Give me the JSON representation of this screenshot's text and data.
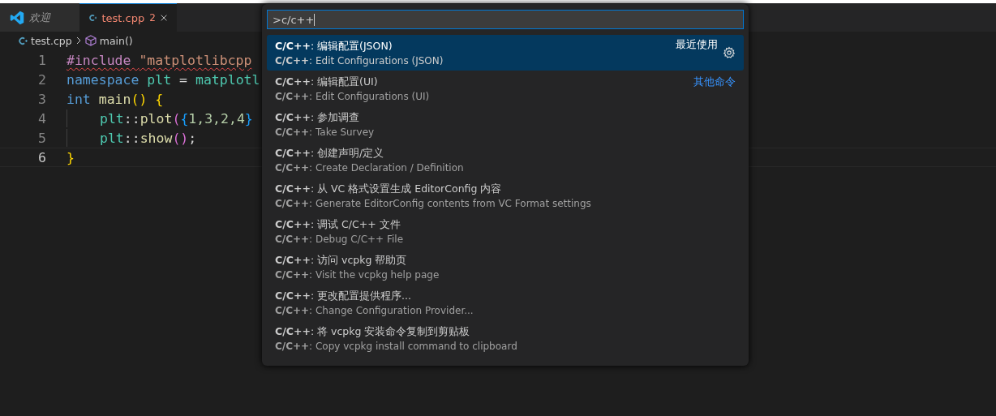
{
  "tabs": [
    {
      "kind": "welcome",
      "label": "欢迎",
      "selected": false,
      "preview": true
    },
    {
      "kind": "cpp",
      "label": "test.cpp",
      "problems": "2",
      "selected": true,
      "preview": false
    }
  ],
  "breadcrumb": [
    {
      "kind": "cpp",
      "label": "test.cpp"
    },
    {
      "kind": "symbol",
      "label": "main()"
    }
  ],
  "code": [
    {
      "number": "1",
      "current": false,
      "error": true,
      "tokens": [
        {
          "text": "#include ",
          "kind": "directive"
        },
        {
          "text": "\"matplotlibcpp",
          "kind": "string"
        }
      ]
    },
    {
      "number": "2",
      "current": false,
      "error": false,
      "tokens": [
        {
          "text": "namespace ",
          "kind": "keyword"
        },
        {
          "text": "plt",
          "kind": "type"
        },
        {
          "text": " = ",
          "kind": "plain"
        },
        {
          "text": "matplotl",
          "kind": "type"
        }
      ]
    },
    {
      "number": "3",
      "current": false,
      "error": false,
      "tokens": [
        {
          "text": "int ",
          "kind": "keyword"
        },
        {
          "text": "main",
          "kind": "function"
        },
        {
          "text": "() ",
          "kind": "bracket1"
        },
        {
          "text": "{",
          "kind": "bracket1"
        }
      ],
      "children": [
        {
          "number": "4",
          "current": false,
          "error": false,
          "tokens": [
            {
              "text": "plt",
              "kind": "type"
            },
            {
              "text": "::",
              "kind": "plain"
            },
            {
              "text": "plot",
              "kind": "function"
            },
            {
              "text": "(",
              "kind": "bracket2"
            },
            {
              "text": "{",
              "kind": "bracket3"
            },
            {
              "text": "1,3,2,4",
              "kind": "number"
            },
            {
              "text": "}",
              "kind": "bracket3"
            }
          ]
        },
        {
          "number": "5",
          "current": false,
          "error": false,
          "tokens": [
            {
              "text": "plt",
              "kind": "type"
            },
            {
              "text": "::",
              "kind": "plain"
            },
            {
              "text": "show",
              "kind": "function"
            },
            {
              "text": "()",
              "kind": "bracket2"
            },
            {
              "text": ";",
              "kind": "plain"
            }
          ]
        }
      ]
    },
    {
      "number": "6",
      "current": true,
      "error": false,
      "tokens": [
        {
          "text": "}",
          "kind": "bracket1"
        }
      ]
    }
  ],
  "palette": {
    "input": ">c/c++",
    "items": [
      {
        "title": "**C/C++**: 编辑配置(JSON)",
        "detail": "**C/C++**: Edit Configurations (JSON)",
        "selected": true,
        "badge": "最近使用",
        "gear": true
      },
      {
        "title": "**C/C++**: 编辑配置(UI)",
        "detail": "**C/C++**: Edit Configurations (UI)",
        "selected": false,
        "link": "其他命令"
      },
      {
        "title": "**C/C++**: 参加调查",
        "detail": "**C/C++**: Take Survey",
        "selected": false
      },
      {
        "title": "**C/C++**: 创建声明/定义",
        "detail": "**C/C++**: Create Declaration / Definition",
        "selected": false
      },
      {
        "title": "**C/C++**: 从 VC 格式设置生成 EditorConfig 内容",
        "detail": "**C/C++**: Generate EditorConfig contents from VC Format settings",
        "selected": false
      },
      {
        "title": "**C/C++**: 调试 C/C++ 文件",
        "detail": "**C/C++**: Debug C/C++ File",
        "selected": false
      },
      {
        "title": "**C/C++**: 访问 vcpkg 帮助页",
        "detail": "**C/C++**: Visit the vcpkg help page",
        "selected": false
      },
      {
        "title": "**C/C++**: 更改配置提供程序...",
        "detail": "**C/C++**: Change Configuration Provider...",
        "selected": false
      },
      {
        "title": "**C/C++**: 将 vcpkg 安装命令复制到剪贴板",
        "detail": "**C/C++**: Copy vcpkg install command to clipboard",
        "selected": false
      }
    ]
  }
}
